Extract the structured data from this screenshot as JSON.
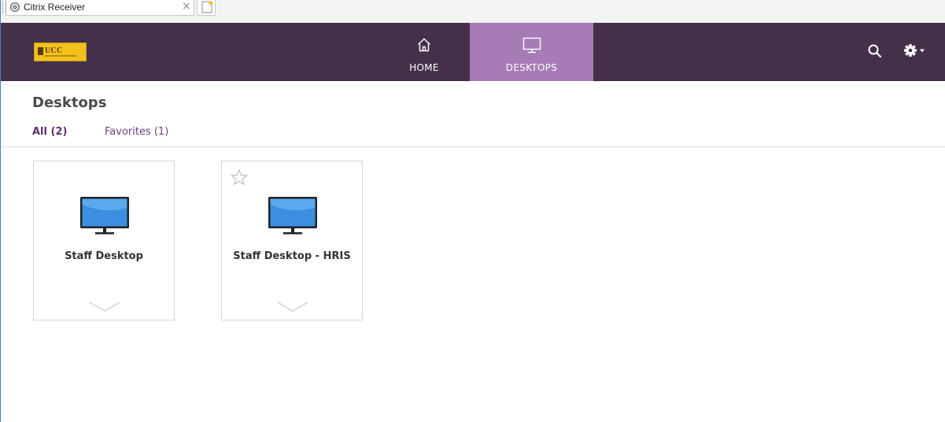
{
  "browser": {
    "tab_title": "Citrix Receiver",
    "close_glyph": "×",
    "favicon": "citrix-receiver-icon",
    "new_tab_icon": "new-tab-icon"
  },
  "header": {
    "logo_text": "UCC",
    "nav": [
      {
        "label": "HOME",
        "icon": "home-icon",
        "active": false
      },
      {
        "label": "DESKTOPS",
        "icon": "monitor-icon",
        "active": true
      }
    ],
    "actions": [
      "search-icon",
      "gear-icon"
    ]
  },
  "page": {
    "title": "Desktops",
    "filters": [
      {
        "label": "All (2)",
        "active": true
      },
      {
        "label": "Favorites (1)",
        "active": false
      }
    ]
  },
  "desktops": [
    {
      "name": "Staff Desktop",
      "favorite_star_visible": false
    },
    {
      "name": "Staff Desktop - HRIS",
      "favorite_star_visible": true
    }
  ],
  "colors": {
    "header_bg": "#45304a",
    "active_tab": "#a77bb5",
    "link": "#6e3d82",
    "monitor_blue": "#3b8ee0"
  }
}
